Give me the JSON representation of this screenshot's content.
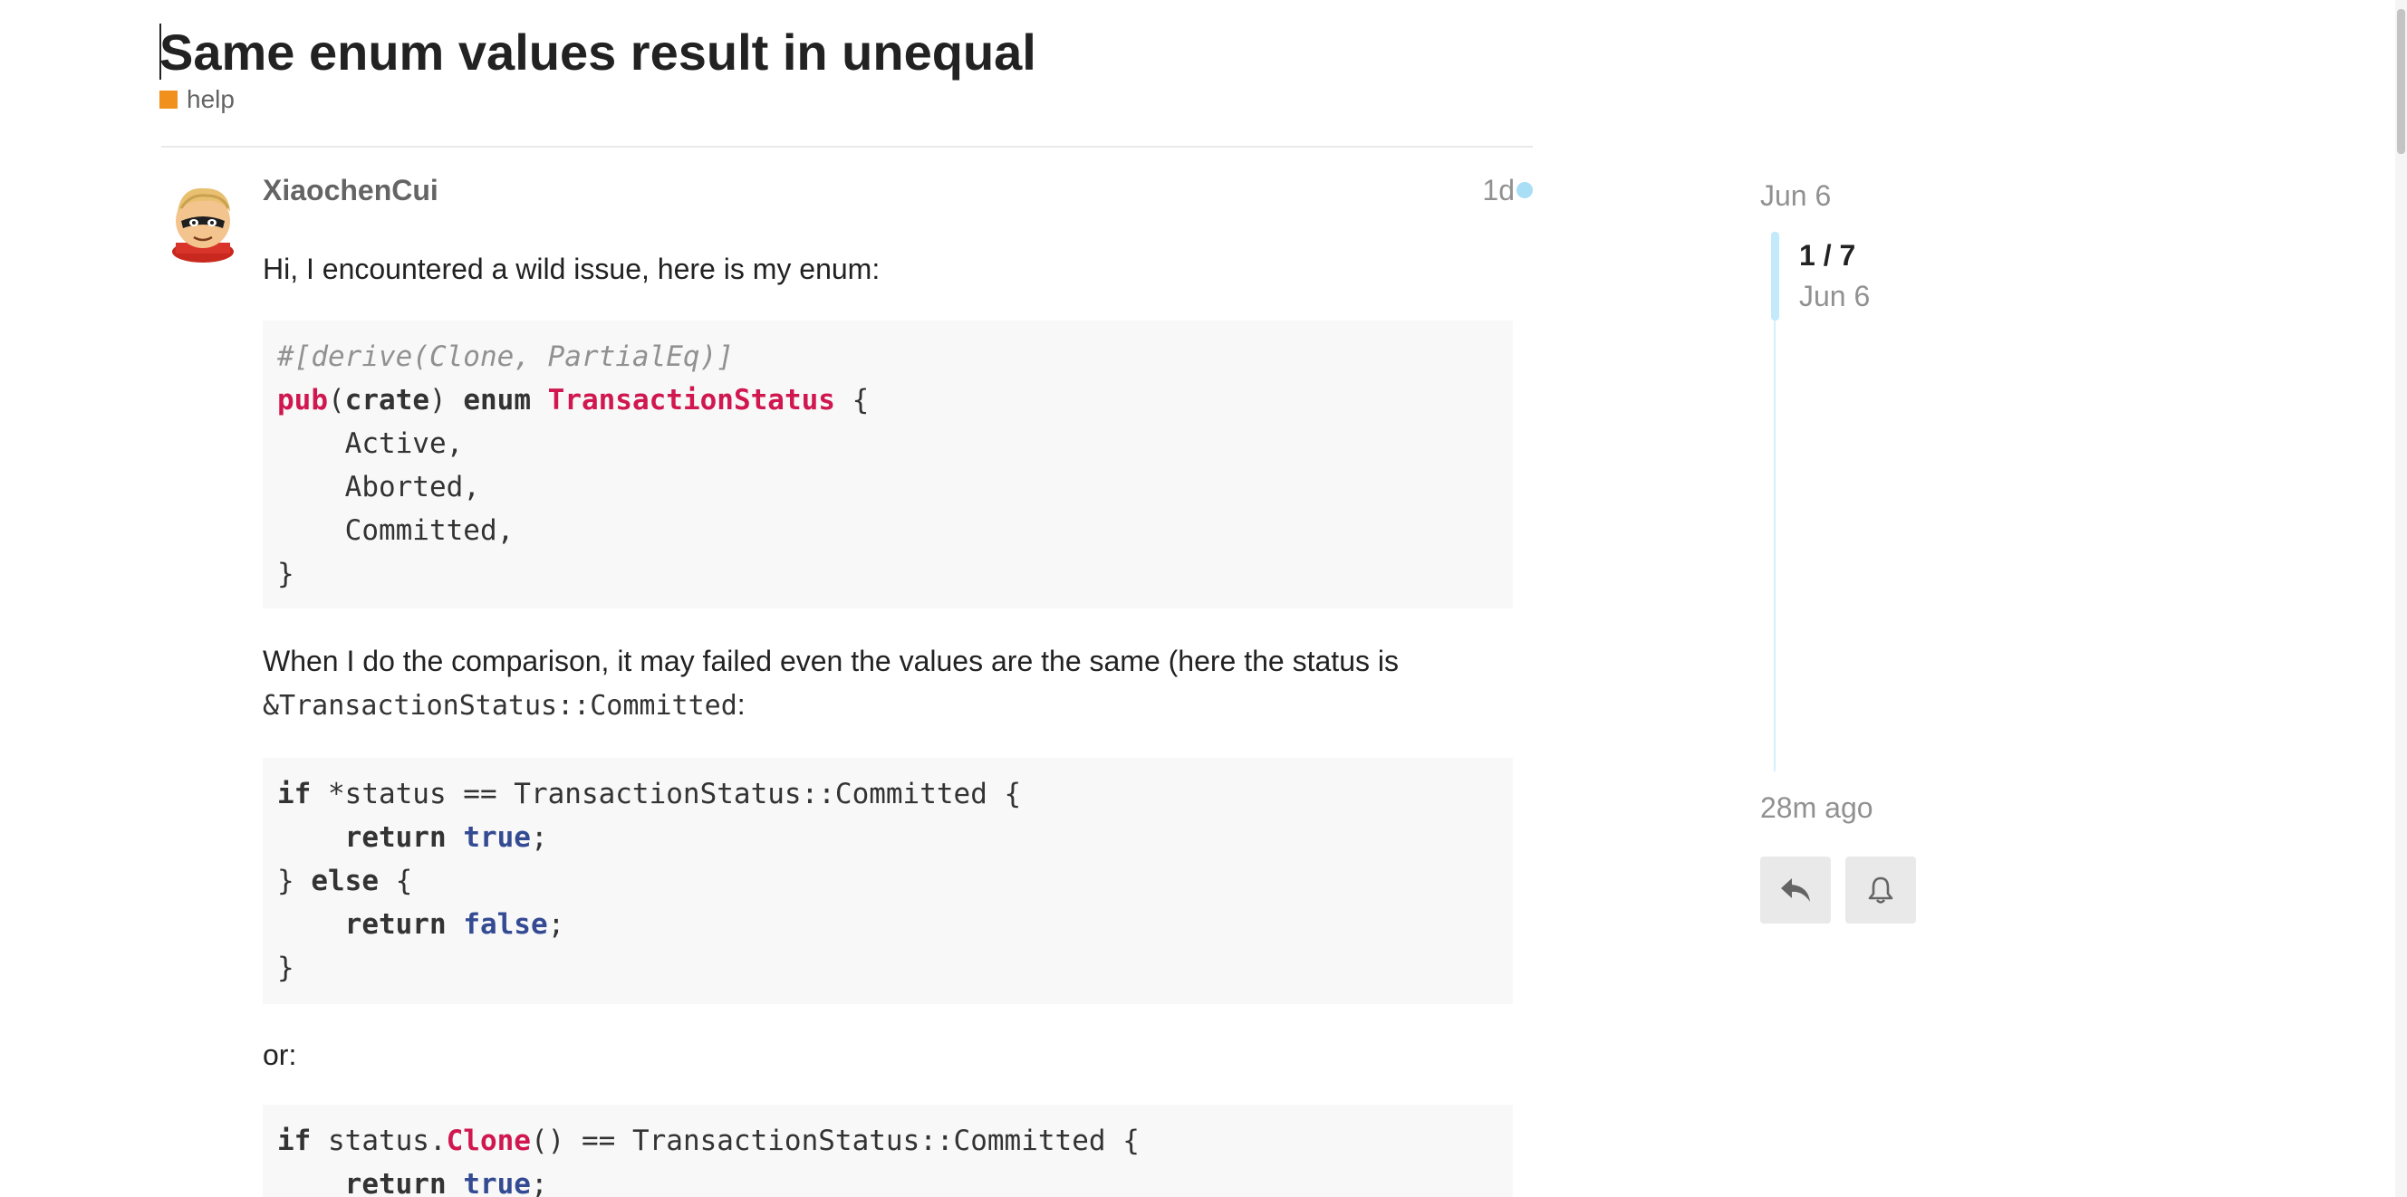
{
  "topic": {
    "title": "Same enum values result in unequal",
    "category": {
      "name": "help",
      "color": "#f1901c"
    }
  },
  "post": {
    "username": "XiaochenCui",
    "age": "1d",
    "unread_color": "#a8dff7",
    "paragraphs": {
      "intro": "Hi, I encountered a wild issue, here is my enum:",
      "compare_prefix": "When I do the comparison, it may failed even the values are the same (here the status is",
      "compare_code": "&TransactionStatus::Committed",
      "compare_suffix": ":",
      "or": "or:"
    },
    "code_enum": [
      [
        {
          "t": "#[derive(Clone, PartialEq)]",
          "c": "comment"
        }
      ],
      [
        {
          "t": "pub",
          "c": "red"
        },
        {
          "t": "(",
          "c": ""
        },
        {
          "t": "crate",
          "c": "kw"
        },
        {
          "t": ") ",
          "c": ""
        },
        {
          "t": "enum",
          "c": "kw"
        },
        {
          "t": " ",
          "c": ""
        },
        {
          "t": "TransactionStatus",
          "c": "red"
        },
        {
          "t": " {",
          "c": ""
        }
      ],
      [
        {
          "t": "    Active,",
          "c": ""
        }
      ],
      [
        {
          "t": "    Aborted,",
          "c": ""
        }
      ],
      [
        {
          "t": "    Committed,",
          "c": ""
        }
      ],
      [
        {
          "t": "}",
          "c": ""
        }
      ]
    ],
    "code_compare1": [
      [
        {
          "t": "if",
          "c": "kw"
        },
        {
          "t": " *status == TransactionStatus::Committed {",
          "c": ""
        }
      ],
      [
        {
          "t": "    ",
          "c": ""
        },
        {
          "t": "return",
          "c": "kw"
        },
        {
          "t": " ",
          "c": ""
        },
        {
          "t": "true",
          "c": "lit"
        },
        {
          "t": ";",
          "c": ""
        }
      ],
      [
        {
          "t": "} ",
          "c": ""
        },
        {
          "t": "else",
          "c": "kw"
        },
        {
          "t": " {",
          "c": ""
        }
      ],
      [
        {
          "t": "    ",
          "c": ""
        },
        {
          "t": "return",
          "c": "kw"
        },
        {
          "t": " ",
          "c": ""
        },
        {
          "t": "false",
          "c": "lit"
        },
        {
          "t": ";",
          "c": ""
        }
      ],
      [
        {
          "t": "}",
          "c": ""
        }
      ]
    ],
    "code_compare2": [
      [
        {
          "t": "if",
          "c": "kw"
        },
        {
          "t": " status.",
          "c": ""
        },
        {
          "t": "Clone",
          "c": "red"
        },
        {
          "t": "() == TransactionStatus::Committed {",
          "c": ""
        }
      ],
      [
        {
          "t": "    ",
          "c": ""
        },
        {
          "t": "return",
          "c": "kw"
        },
        {
          "t": " ",
          "c": ""
        },
        {
          "t": "true",
          "c": "lit"
        },
        {
          "t": ";",
          "c": ""
        }
      ]
    ]
  },
  "timeline": {
    "start_date": "Jun 6",
    "position": "1 / 7",
    "position_date": "Jun 6",
    "end_label": "28m ago",
    "accent_color": "#c2eafb",
    "buttons": {
      "reply": "reply-icon",
      "notifications": "bell-icon"
    }
  }
}
